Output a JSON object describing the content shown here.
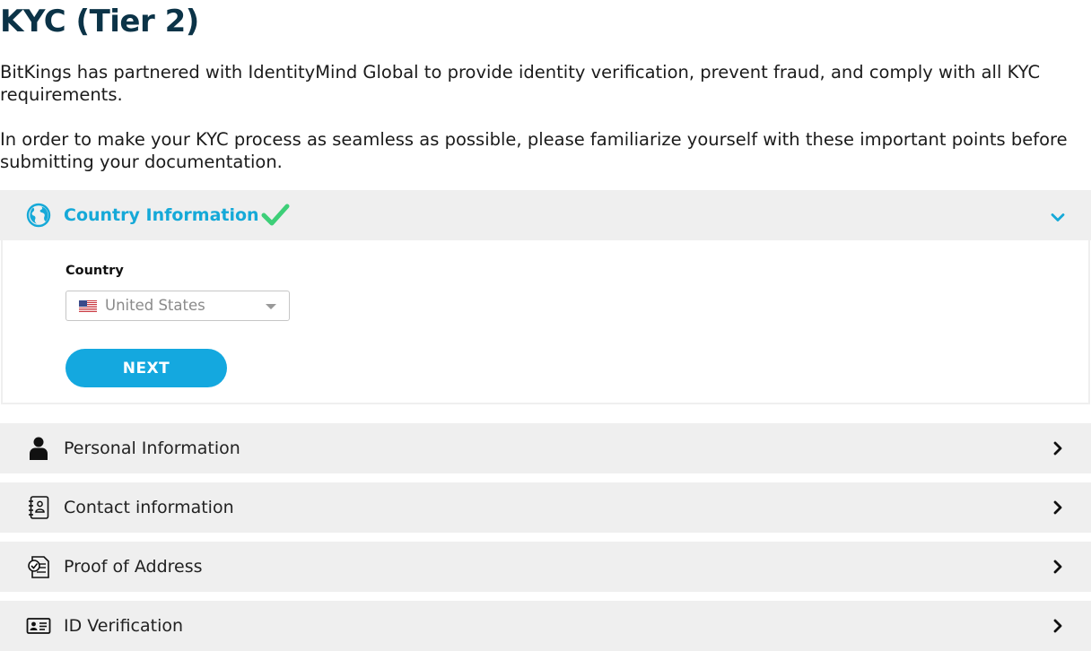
{
  "page": {
    "title": "KYC (Tier 2)",
    "intro_1": "BitKings has partnered with IdentityMind Global to provide identity verification, prevent fraud, and comply with all KYC requirements.",
    "intro_2": "In order to make your KYC process as seamless as possible, please familiarize yourself with these important points before submitting your documentation."
  },
  "sections": {
    "country": {
      "title": "Country Information",
      "icon": "globe-icon",
      "status": "complete",
      "expanded": true,
      "field_label": "Country",
      "selected_country": "United States",
      "selected_flag": "us-flag-icon",
      "next_label": "NEXT"
    },
    "personal": {
      "title": "Personal Information",
      "icon": "person-icon"
    },
    "contact": {
      "title": "Contact information",
      "icon": "address-book-icon"
    },
    "proof": {
      "title": "Proof of Address",
      "icon": "certificate-document-icon"
    },
    "id": {
      "title": "ID Verification",
      "icon": "id-card-icon"
    }
  },
  "colors": {
    "heading": "#0b3347",
    "accent": "#14a8df",
    "check": "#3dcf78",
    "header_bg": "#efefef"
  }
}
